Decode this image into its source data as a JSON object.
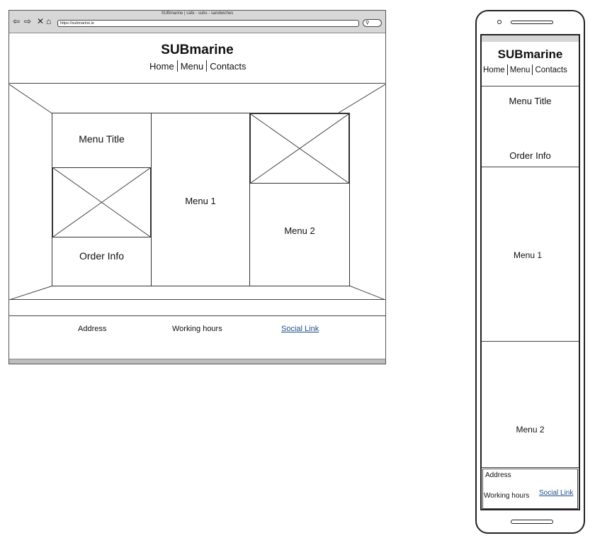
{
  "desktop": {
    "window_title": "SUBmarine | cafe - subs - sandwiches",
    "address_url": "https://submarine.ie",
    "nav_icons": [
      "back-arrow-icon",
      "forward-arrow-icon",
      "stop-icon",
      "home-icon"
    ],
    "site_title": "SUBmarine",
    "nav": [
      "Home",
      "Menu",
      "Contacts"
    ],
    "sections": {
      "menu_title": "Menu Title",
      "order_info": "Order Info",
      "menu_1": "Menu 1",
      "menu_2": "Menu 2"
    },
    "footer": {
      "address": "Address",
      "working_hours": "Working hours",
      "social_link": "Social Link"
    }
  },
  "mobile": {
    "site_title": "SUBmarine",
    "nav": [
      "Home",
      "Menu",
      "Contacts"
    ],
    "sections": {
      "menu_title": "Menu Title",
      "order_info": "Order Info",
      "menu_1": "Menu 1",
      "menu_2": "Menu 2"
    },
    "footer": {
      "address": "Address",
      "working_hours": "Working hours",
      "social_link": "Social Link"
    }
  },
  "colors": {
    "line": "#333333",
    "chrome": "#d7d7d7",
    "link": "#1f4e8c"
  }
}
